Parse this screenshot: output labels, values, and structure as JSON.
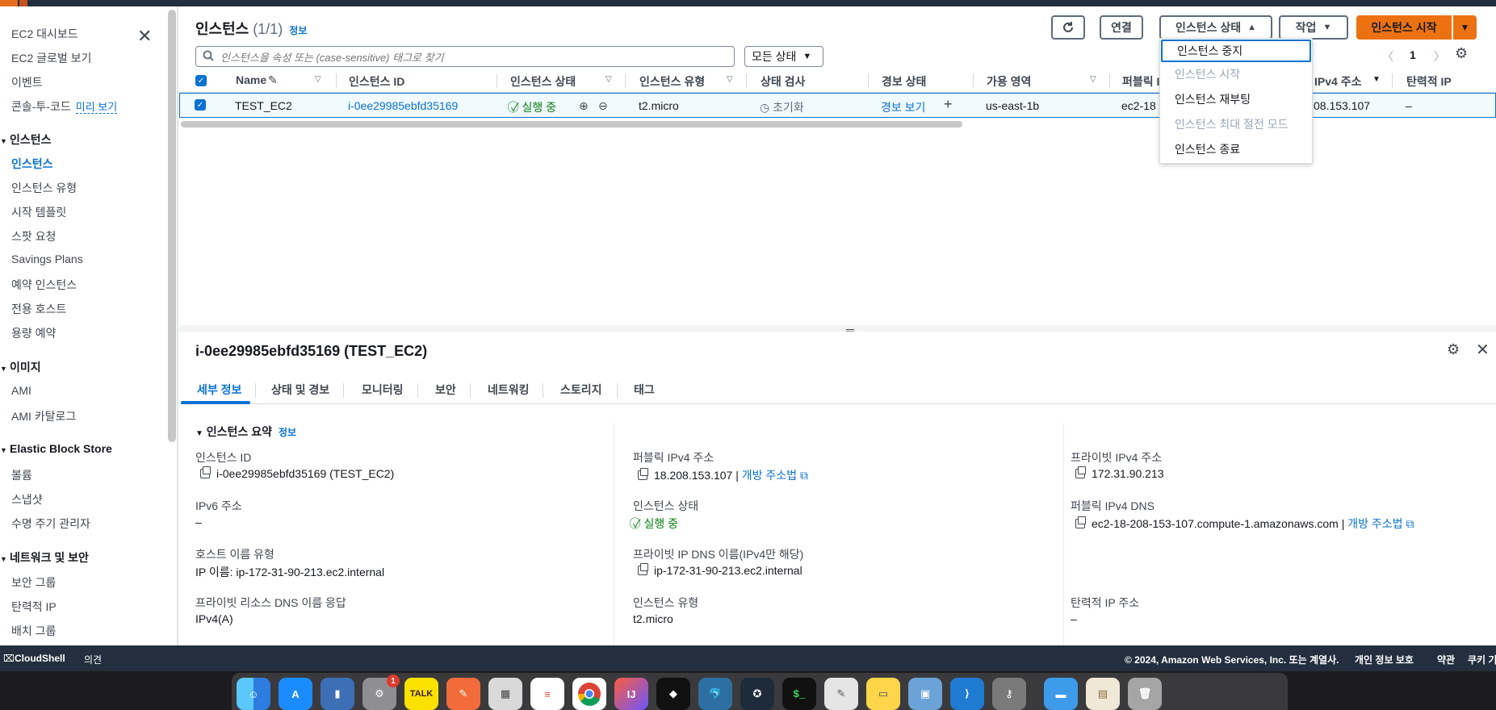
{
  "sidebar": {
    "items_top": [
      "EC2 대시보드",
      "EC2 글로벌 보기",
      "이벤트",
      "콘솔-투-코드"
    ],
    "preview_label": "미리 보기",
    "sections": [
      {
        "title": "인스턴스",
        "items": [
          "인스턴스",
          "인스턴스 유형",
          "시작 템플릿",
          "스팟 요청",
          "Savings Plans",
          "예약 인스턴스",
          "전용 호스트",
          "용량 예약"
        ]
      },
      {
        "title": "이미지",
        "items": [
          "AMI",
          "AMI 카탈로그"
        ]
      },
      {
        "title": "Elastic Block Store",
        "items": [
          "볼륨",
          "스냅샷",
          "수명 주기 관리자"
        ]
      },
      {
        "title": "네트워크 및 보안",
        "items": [
          "보안 그룹",
          "탄력적 IP",
          "배치 그룹"
        ]
      }
    ]
  },
  "header": {
    "title": "인스턴스",
    "count": "(1/1)",
    "info": "정보",
    "connect": "연결",
    "instance_state": "인스턴스 상태",
    "actions": "작업",
    "launch": "인스턴스 시작"
  },
  "search": {
    "placeholder": "인스턴스을 속성 또는 (case-sensitive) 태그로 찾기"
  },
  "state_filter": "모든 상태",
  "pager": {
    "page": "1"
  },
  "table": {
    "columns": [
      "Name",
      "인스턴스 ID",
      "인스턴스 상태",
      "인스턴스 유형",
      "상태 검사",
      "경보 상태",
      "가용 영역",
      "퍼블릭 I",
      "IPv4 주소",
      "탄력적 IP"
    ],
    "row": {
      "name": "TEST_EC2",
      "id": "i-0ee29985ebfd35169",
      "state": "실행 중",
      "type": "t2.micro",
      "check": "초기화",
      "alarm": "경보 보기",
      "az": "us-east-1b",
      "public_dns": "ec2-18",
      "ipv4": "08.153.107",
      "eip": "–"
    }
  },
  "dropdown": {
    "items": [
      {
        "label": "인스턴스 중지",
        "disabled": false
      },
      {
        "label": "인스턴스 시작",
        "disabled": true
      },
      {
        "label": "인스턴스 재부팅",
        "disabled": false
      },
      {
        "label": "인스턴스 최대 절전 모드",
        "disabled": true
      },
      {
        "label": "인스턴스 종료",
        "disabled": false
      }
    ]
  },
  "details": {
    "title": "i-0ee29985ebfd35169 (TEST_EC2)",
    "tabs": [
      "세부 정보",
      "상태 및 경보",
      "모니터링",
      "보안",
      "네트워킹",
      "스토리지",
      "태그"
    ],
    "section": "인스턴스 요약",
    "section_info": "정보",
    "fields": {
      "instance_id_label": "인스턴스 ID",
      "instance_id": "i-0ee29985ebfd35169 (TEST_EC2)",
      "ipv6_label": "IPv6 주소",
      "ipv6": "–",
      "hostname_type_label": "호스트 이름 유형",
      "hostname_type": "IP 이름: ip-172-31-90-213.ec2.internal",
      "private_dns_resp_label": "프라이빗 리소스 DNS 이름 응답",
      "private_dns_resp": "IPv4(A)",
      "public_ipv4_label": "퍼블릭 IPv4 주소",
      "public_ipv4": "18.208.153.107",
      "open_address": "개방 주소법",
      "state_label": "인스턴스 상태",
      "state": "실행 중",
      "private_ip_dns_label": "프라이빗 IP DNS 이름(IPv4만 해당)",
      "private_ip_dns": "ip-172-31-90-213.ec2.internal",
      "instance_type_label": "인스턴스 유형",
      "instance_type": "t2.micro",
      "private_ipv4_label": "프라이빗 IPv4 주소",
      "private_ipv4": "172.31.90.213",
      "public_dns_label": "퍼블릭 IPv4 DNS",
      "public_dns": "ec2-18-208-153-107.compute-1.amazonaws.com",
      "eip_label": "탄력적 IP 주소",
      "eip": "–"
    }
  },
  "footer": {
    "cloudshell": "CloudShell",
    "feedback": "의견",
    "copyright": "© 2024, Amazon Web Services, Inc. 또는 계열사.",
    "privacy": "개인 정보 보호",
    "terms": "약관",
    "cookies": "쿠키 기"
  },
  "dock": {
    "badge": "1",
    "talk": "TALK",
    "ij": "IJ"
  },
  "colors": {
    "accent": "#0972d3",
    "primary": "#ec7211",
    "success": "#037f0c",
    "nav": "#232f3e"
  }
}
